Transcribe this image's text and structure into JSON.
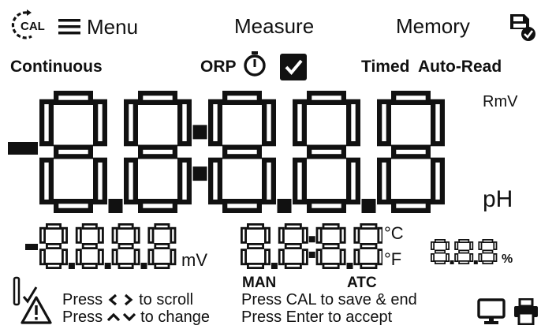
{
  "top_bar": {
    "cal_label": "CAL",
    "menu_label": "Menu",
    "measure_label": "Measure",
    "memory_label": "Memory"
  },
  "status_row": {
    "mode": "Continuous",
    "parameter": "ORP",
    "timed_label": "Timed",
    "auto_read_label": "Auto-Read",
    "timed_checked": true
  },
  "main_display": {
    "sign": "-",
    "digits": "8.8:8.8.8",
    "unit_top": "RmV",
    "unit_bottom": "pH"
  },
  "secondary": {
    "mv_sign": "-",
    "mv_digits": "8.8.8.8",
    "mv_unit": "mV",
    "temp_digits": "8.8:8.8",
    "unit_c": "°C",
    "unit_f": "°F",
    "man_label": "MAN",
    "atc_label": "ATC",
    "pct_digits": "8.8.8",
    "pct_unit": "%"
  },
  "hints": {
    "scroll_press": "Press",
    "scroll_rest": "to scroll",
    "change_press": "Press",
    "change_rest": "to change",
    "save": "Press CAL to save & end",
    "accept": "Press Enter to accept"
  },
  "icons": [
    "cal-icon",
    "menu-icon",
    "memory-save-icon",
    "timer-icon",
    "checkbox-icon",
    "probe-check-icon",
    "warning-icon",
    "computer-icon",
    "printer-icon",
    "left-right-arrows-icon",
    "up-down-arrows-icon"
  ]
}
